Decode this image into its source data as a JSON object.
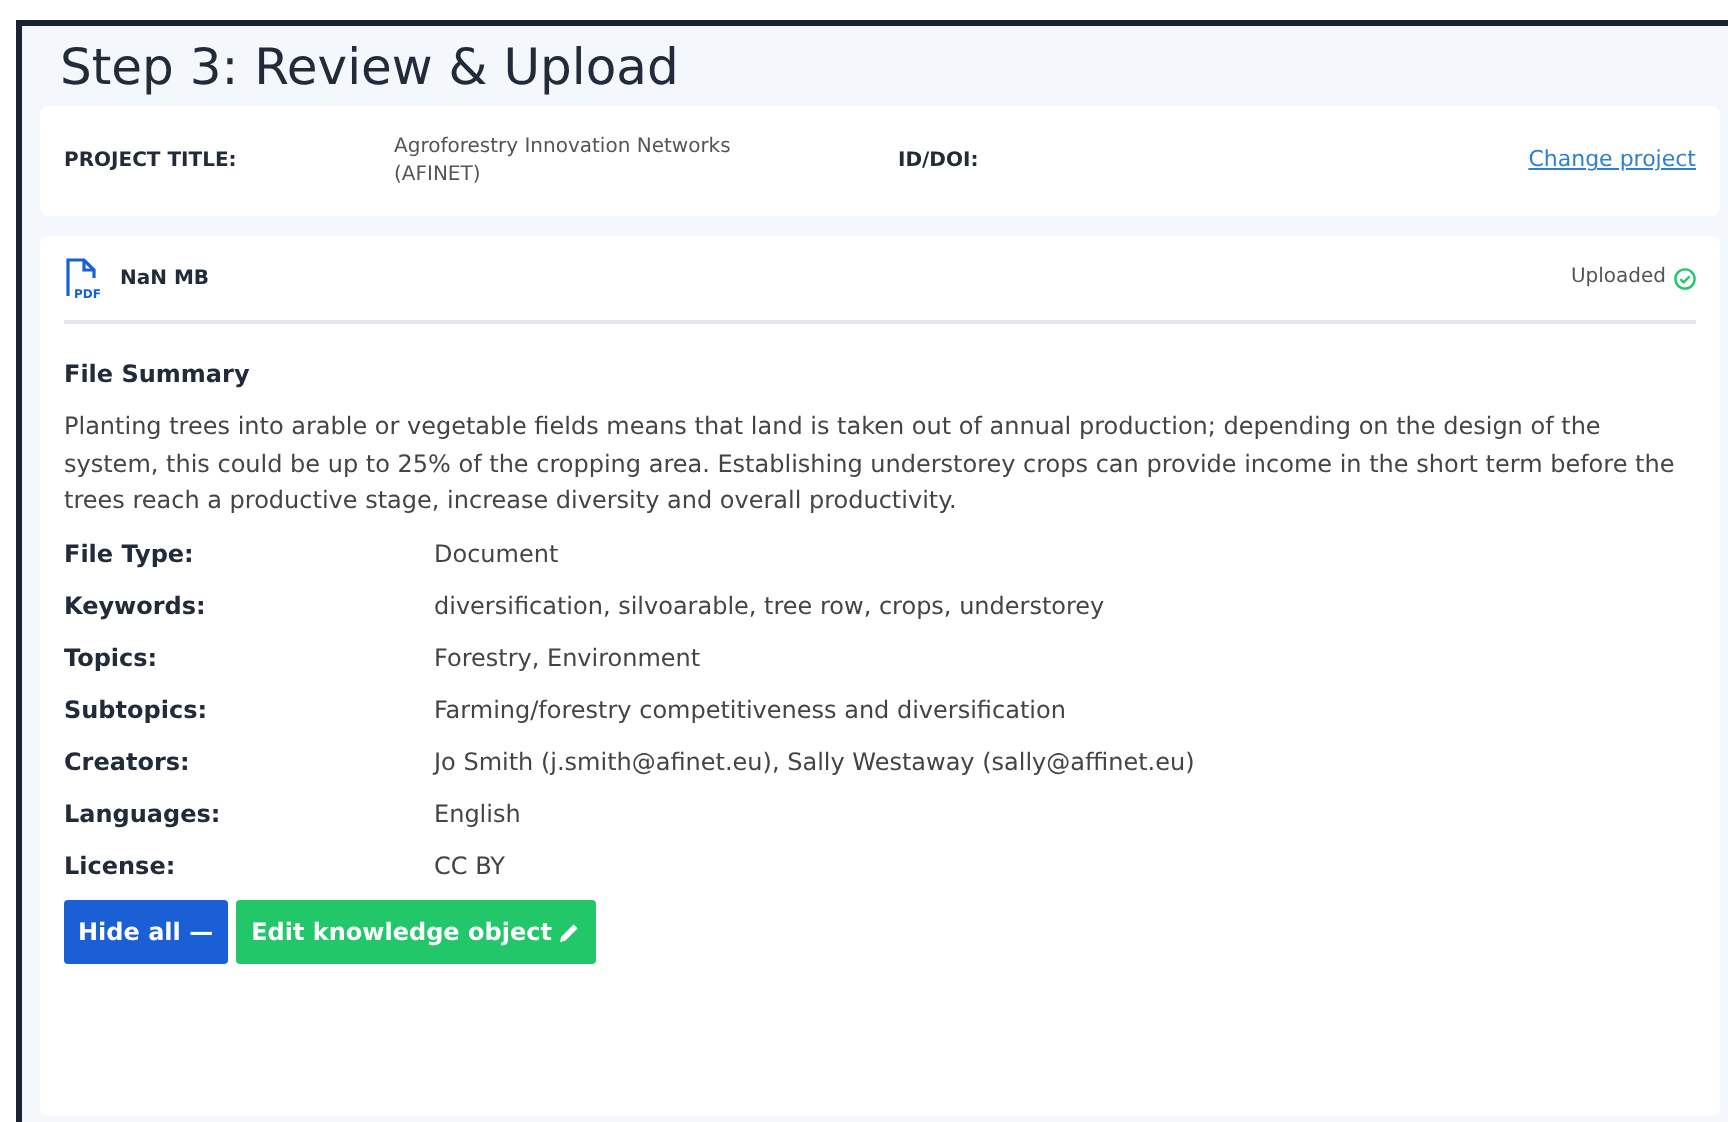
{
  "heading": "Step 3: Review & Upload",
  "project": {
    "title_label": "PROJECT TITLE:",
    "title_value": "Agroforestry Innovation Networks (AFINET)",
    "id_label": "ID/DOI:",
    "change_link": "Change project"
  },
  "file": {
    "icon_text": "PDF",
    "size": "NaN MB",
    "status": "Uploaded",
    "summary_title": "File Summary",
    "summary": "Planting trees into arable or vegetable fields means that land is taken out of annual production; depending on the design of the system, this could be up to 25% of the cropping area. Establishing understorey crops can provide income in the short term before the trees reach a productive stage, increase diversity and overall productivity.",
    "details": [
      {
        "label": "File Type:",
        "value": "Document"
      },
      {
        "label": "Keywords:",
        "value": "diversification, silvoarable, tree row, crops, understorey"
      },
      {
        "label": "Topics:",
        "value": "Forestry, Environment"
      },
      {
        "label": "Subtopics:",
        "value": "Farming/forestry competitiveness and diversification"
      },
      {
        "label": "Creators:",
        "value": "Jo Smith (j.smith@afinet.eu), Sally Westaway (sally@affinet.eu)"
      },
      {
        "label": "Languages:",
        "value": "English"
      },
      {
        "label": "License:",
        "value": "CC BY"
      }
    ]
  },
  "buttons": [
    {
      "kind": "hide",
      "label": "Hide all —"
    },
    {
      "kind": "edit",
      "label": "Edit knowledge object"
    }
  ]
}
